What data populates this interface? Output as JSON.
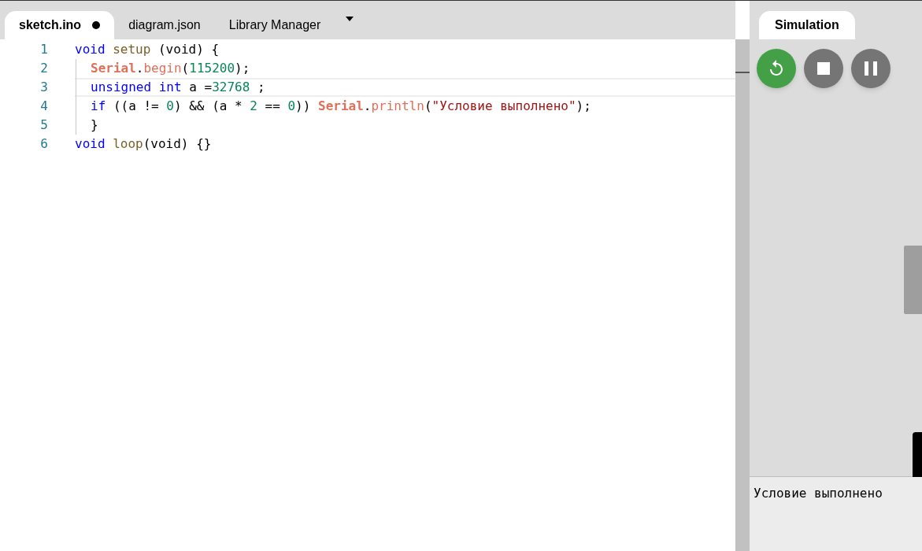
{
  "editor_tabs": [
    {
      "label": "sketch.ino",
      "selected": true,
      "modified": true
    },
    {
      "label": "diagram.json",
      "selected": false,
      "modified": false
    },
    {
      "label": "Library Manager",
      "selected": false,
      "modified": false
    }
  ],
  "code_lines": [
    {
      "number": "1",
      "indented": false,
      "current": false,
      "tokens": [
        {
          "kind": "keyword",
          "text": "void "
        },
        {
          "kind": "function",
          "text": "setup"
        },
        {
          "kind": "plain",
          "text": " (void) {"
        }
      ]
    },
    {
      "number": "2",
      "indented": true,
      "current": false,
      "tokens": [
        {
          "kind": "class",
          "text": "Serial"
        },
        {
          "kind": "plain",
          "text": "."
        },
        {
          "kind": "method",
          "text": "begin"
        },
        {
          "kind": "plain",
          "text": "("
        },
        {
          "kind": "number",
          "text": "115200"
        },
        {
          "kind": "plain",
          "text": ");"
        }
      ]
    },
    {
      "number": "3",
      "indented": true,
      "current": true,
      "tokens": [
        {
          "kind": "keyword",
          "text": "unsigned int"
        },
        {
          "kind": "plain",
          "text": " a ="
        },
        {
          "kind": "number",
          "text": "32768"
        },
        {
          "kind": "plain",
          "text": " ;"
        }
      ]
    },
    {
      "number": "4",
      "indented": true,
      "current": false,
      "tokens": [
        {
          "kind": "keyword",
          "text": "if"
        },
        {
          "kind": "plain",
          "text": " ((a != "
        },
        {
          "kind": "number",
          "text": "0"
        },
        {
          "kind": "plain",
          "text": ") && (a * "
        },
        {
          "kind": "number",
          "text": "2"
        },
        {
          "kind": "plain",
          "text": " == "
        },
        {
          "kind": "number",
          "text": "0"
        },
        {
          "kind": "plain",
          "text": ")) "
        },
        {
          "kind": "class",
          "text": "Serial"
        },
        {
          "kind": "plain",
          "text": "."
        },
        {
          "kind": "method",
          "text": "println"
        },
        {
          "kind": "plain",
          "text": "("
        },
        {
          "kind": "string",
          "text": "\"Условие выполнено\""
        },
        {
          "kind": "plain",
          "text": ");"
        }
      ]
    },
    {
      "number": "5",
      "indented": true,
      "current": false,
      "tokens": [
        {
          "kind": "plain",
          "text": "}"
        }
      ]
    },
    {
      "number": "6",
      "indented": false,
      "current": false,
      "tokens": [
        {
          "kind": "keyword",
          "text": "void "
        },
        {
          "kind": "function",
          "text": "loop"
        },
        {
          "kind": "plain",
          "text": "(void) {}"
        }
      ]
    }
  ],
  "simulation": {
    "tab": {
      "label": "Simulation",
      "selected": true
    },
    "controls": [
      {
        "kind": "restart"
      },
      {
        "kind": "stop"
      },
      {
        "kind": "pause"
      }
    ],
    "serial_output": "Условие выполнено"
  }
}
